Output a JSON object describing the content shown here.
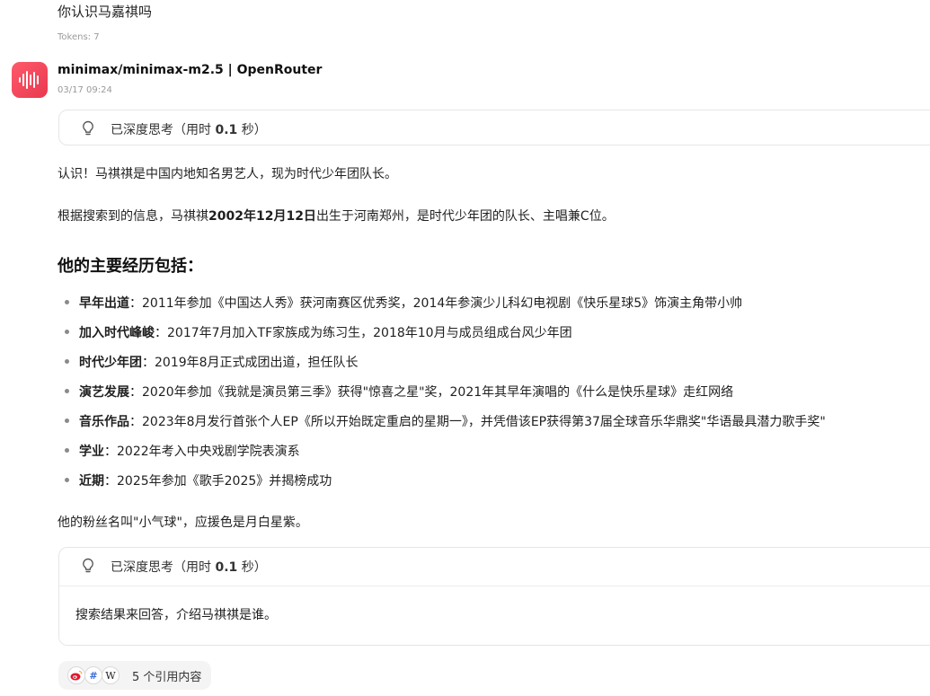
{
  "user_message": {
    "text": "你认识马嘉祺吗",
    "tokens": "Tokens: 7"
  },
  "assistant": {
    "model": "minimax/minimax-m2.5 | OpenRouter",
    "timestamp": "03/17 09:24",
    "avatar_color": "#e8384f",
    "thinking_top": {
      "prefix": "已深度思考（用时 ",
      "value": "0.1",
      "suffix": " 秒）"
    },
    "para1": "认识！马祺祺是中国内地知名男艺人，现为时代少年团队长。",
    "para2": {
      "pre": "根据搜索到的信息，马祺祺",
      "bold": "2002年12月12日",
      "post": "出生于河南郑州，是时代少年团的队长、主唱兼C位。"
    },
    "heading": "他的主要经历包括：",
    "bullets": [
      {
        "term": "早年出道",
        "text": "：2011年参加《中国达人秀》获河南赛区优秀奖，2014年参演少儿科幻电视剧《快乐星球5》饰演主角带小帅"
      },
      {
        "term": "加入时代峰峻",
        "text": "：2017年7月加入TF家族成为练习生，2018年10月与成员组成台风少年团"
      },
      {
        "term": "时代少年团",
        "text": "：2019年8月正式成团出道，担任队长"
      },
      {
        "term": "演艺发展",
        "text": "：2020年参加《我就是演员第三季》获得\"惊喜之星\"奖，2021年其早年演唱的《什么是快乐星球》走红网络"
      },
      {
        "term": "音乐作品",
        "text": "：2023年8月发行首张个人EP《所以开始既定重启的星期一》，并凭借该EP获得第37届全球音乐华鼎奖\"华语最具潜力歌手奖\""
      },
      {
        "term": "学业",
        "text": "：2022年考入中央戏剧学院表演系"
      },
      {
        "term": "近期",
        "text": "：2025年参加《歌手2025》并揭榜成功"
      }
    ],
    "para3": "他的粉丝名叫\"小气球\"，应援色是月白星紫。",
    "thinking_bottom": {
      "prefix": "已深度思考（用时 ",
      "value": "0.1",
      "suffix": " 秒）",
      "content": "搜索结果来回答，介绍马祺祺是谁。"
    },
    "citations": {
      "label": "5 个引用内容",
      "icons": [
        "weibo-icon",
        "hash-icon",
        "wikipedia-icon"
      ],
      "wiki_letter": "W",
      "hash_letter": "#"
    }
  }
}
